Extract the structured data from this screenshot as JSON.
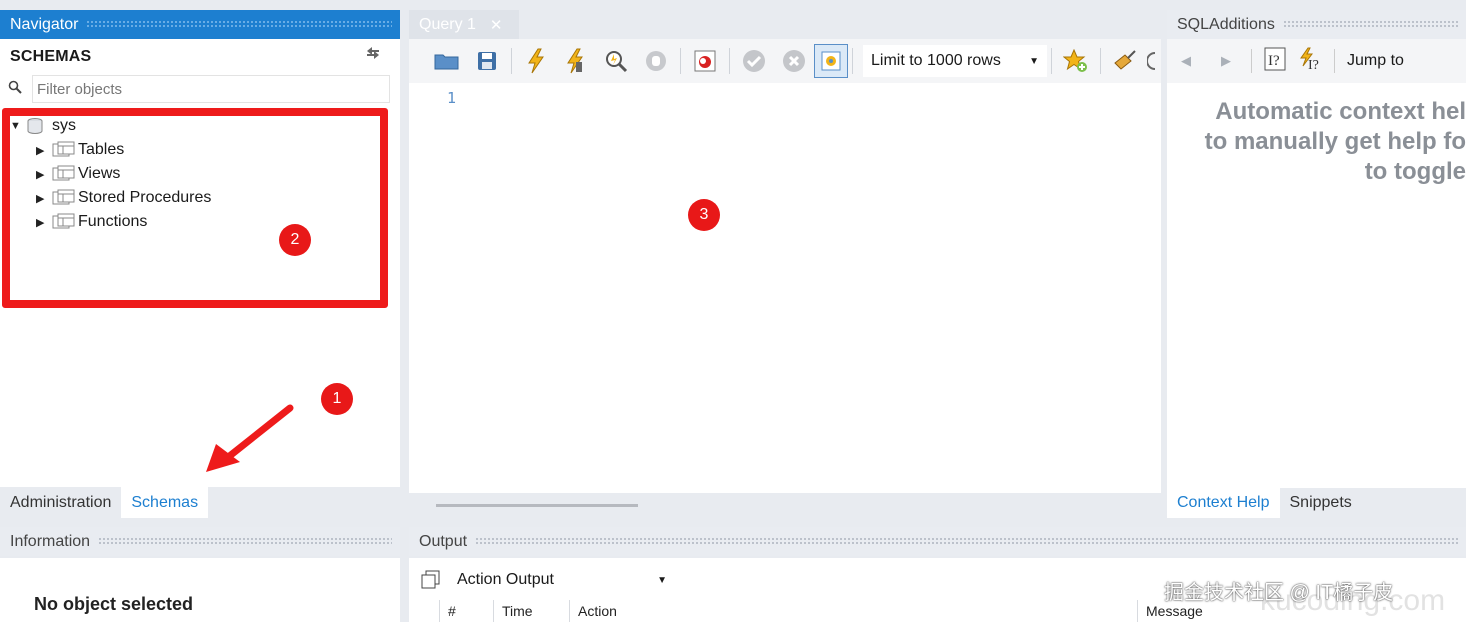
{
  "navigator": {
    "title": "Navigator",
    "schemas_label": "SCHEMAS",
    "filter_placeholder": "Filter objects",
    "tree": {
      "root": "sys",
      "children": [
        "Tables",
        "Views",
        "Stored Procedures",
        "Functions"
      ]
    },
    "tabs": [
      "Administration",
      "Schemas"
    ],
    "active_tab": "Schemas"
  },
  "query": {
    "tab_label": "Query 1",
    "limit_select": "Limit to 1000 rows",
    "line_number": "1"
  },
  "sql_additions": {
    "title": "SQLAdditions",
    "jump_to": "Jump to",
    "help_lines": [
      "Automatic context hel",
      "to manually get help fo",
      "to toggle"
    ],
    "tabs": [
      "Context Help",
      "Snippets"
    ],
    "active_tab": "Context Help"
  },
  "information": {
    "title": "Information",
    "message": "No object selected"
  },
  "output": {
    "title": "Output",
    "select_value": "Action Output",
    "columns": [
      "#",
      "Time",
      "Action",
      "Message"
    ]
  },
  "annotations": {
    "badge_1": "1",
    "badge_2": "2",
    "badge_3": "3"
  },
  "watermark": {
    "text": "掘金技术社区 @ IT橘子皮",
    "faint": "kucoding.com"
  },
  "colors": {
    "accent": "#1d7fd0",
    "annotation_red": "#e81818"
  }
}
